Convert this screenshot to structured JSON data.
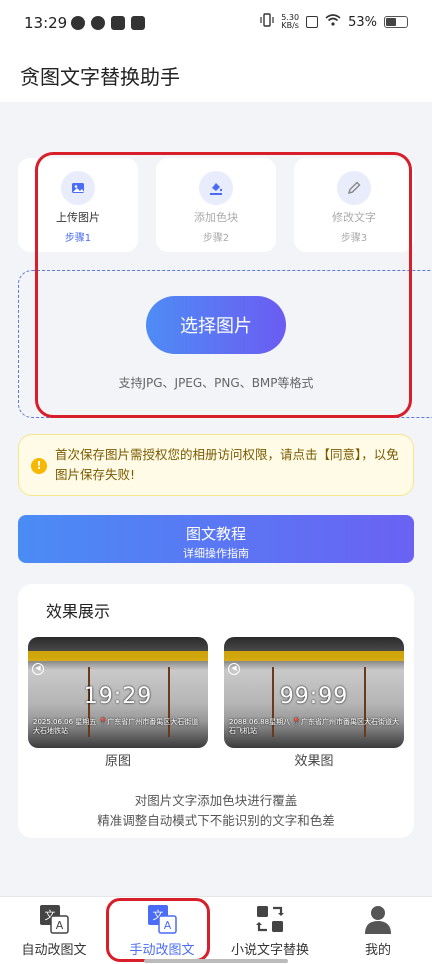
{
  "status_bar": {
    "time": "13:29",
    "net_speed_value": "5.30",
    "net_speed_unit": "KB/s",
    "battery": "53%",
    "battery_level": 0.53
  },
  "app": {
    "title": "贪图文字替换助手"
  },
  "steps": [
    {
      "label": "上传图片",
      "num": "步骤1",
      "icon": "image-icon",
      "active": true
    },
    {
      "label": "添加色块",
      "num": "步骤2",
      "icon": "paint-bucket-icon",
      "active": false
    },
    {
      "label": "修改文字",
      "num": "步骤3",
      "icon": "pencil-icon",
      "active": false
    }
  ],
  "upload": {
    "button_label": "选择图片",
    "formats": "支持JPG、JPEG、PNG、BMP等格式"
  },
  "notice": {
    "text": "首次保存图片需授权您的相册访问权限，请点击【同意】，以免图片保存失败!",
    "icon": "warning-icon"
  },
  "tutorial": {
    "title": "图文教程",
    "subtitle": "详细操作指南"
  },
  "effect": {
    "title": "效果展示",
    "original": {
      "time": "19:29",
      "caption": "2025.06.06 星期五 📍广东省广州市番禺区大石街道大石地铁站",
      "label": "原图"
    },
    "result": {
      "time": "99:99",
      "caption": "2088.06.88星期八 📍广东省广州市番禺区大石街道大石飞机站",
      "label": "效果图"
    },
    "desc_line1": "对图片文字添加色块进行覆盖",
    "desc_line2": "精准调整自动模式下不能识别的文字和色差"
  },
  "bottom_nav": [
    {
      "label": "自动改图文",
      "icon": "translate-icon",
      "active": false
    },
    {
      "label": "手动改图文",
      "icon": "translate-icon",
      "active": true
    },
    {
      "label": "小说文字替换",
      "icon": "swap-icon",
      "active": false
    },
    {
      "label": "我的",
      "icon": "user-icon",
      "active": false
    }
  ],
  "colors": {
    "accent": "#4a6cf7",
    "highlight": "#d81e2b",
    "notice_bg": "#fffbe6"
  }
}
